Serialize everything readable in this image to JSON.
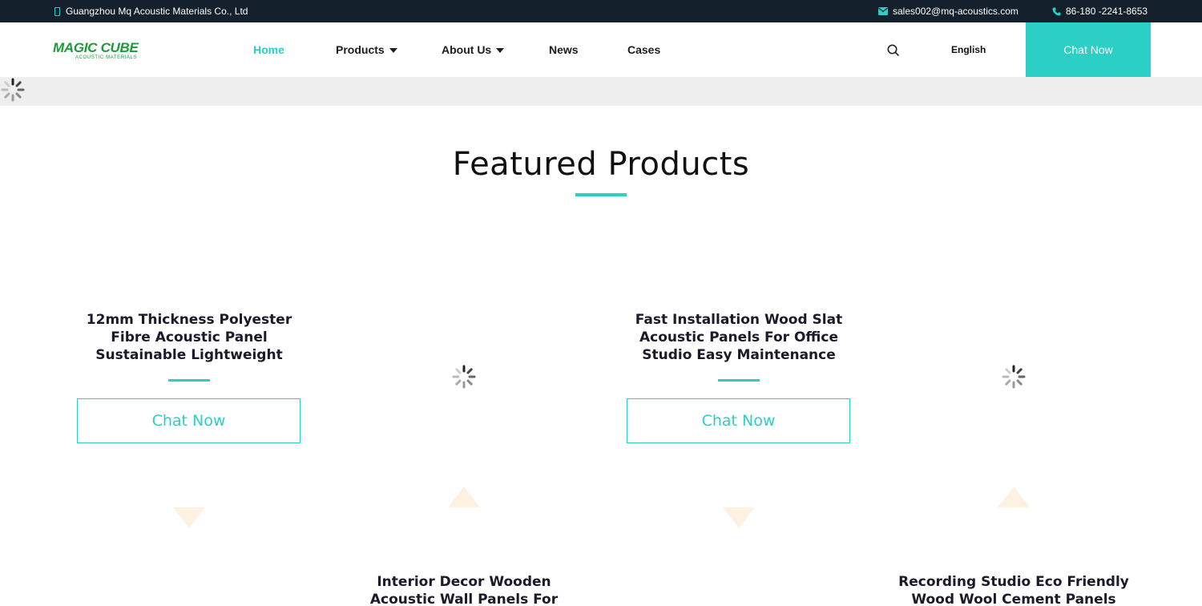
{
  "topbar": {
    "company": "Guangzhou Mq Acoustic Materials Co., Ltd",
    "email": "sales002@mq-acoustics.com",
    "phone": "86-180 -2241-8653"
  },
  "header": {
    "logo_text": "MAGIC CUBE",
    "logo_sub": "ACOUSTIC MATERIALS",
    "nav": [
      {
        "label": "Home"
      },
      {
        "label": "Products"
      },
      {
        "label": "About Us"
      },
      {
        "label": "News"
      },
      {
        "label": "Cases"
      }
    ],
    "language": "English",
    "chat_label": "Chat Now"
  },
  "section": {
    "title": "Featured Products"
  },
  "products": [
    {
      "title": "12mm Thickness Polyester Fibre Acoustic Panel Sustainable Lightweight",
      "button": "Chat Now"
    },
    {
      "title": "Fast Installation Wood Slat Acoustic Panels For Office Studio Easy Maintenance",
      "button": "Chat Now"
    },
    {
      "title": "Interior Decor Wooden Acoustic Wall Panels For Sound Absorption"
    },
    {
      "title": "Recording Studio Eco Friendly Wood Wool Cement Panels High"
    }
  ],
  "colors": {
    "accent": "#2ccfc5",
    "topbar_bg": "#14202c",
    "banner_bg": "#eeeeee",
    "logo_green": "#1d9a3a"
  },
  "icons": {
    "company": "mobile-icon",
    "email": "envelope-icon",
    "phone": "phone-icon",
    "search": "search-icon",
    "loading": "spinner-icon"
  }
}
